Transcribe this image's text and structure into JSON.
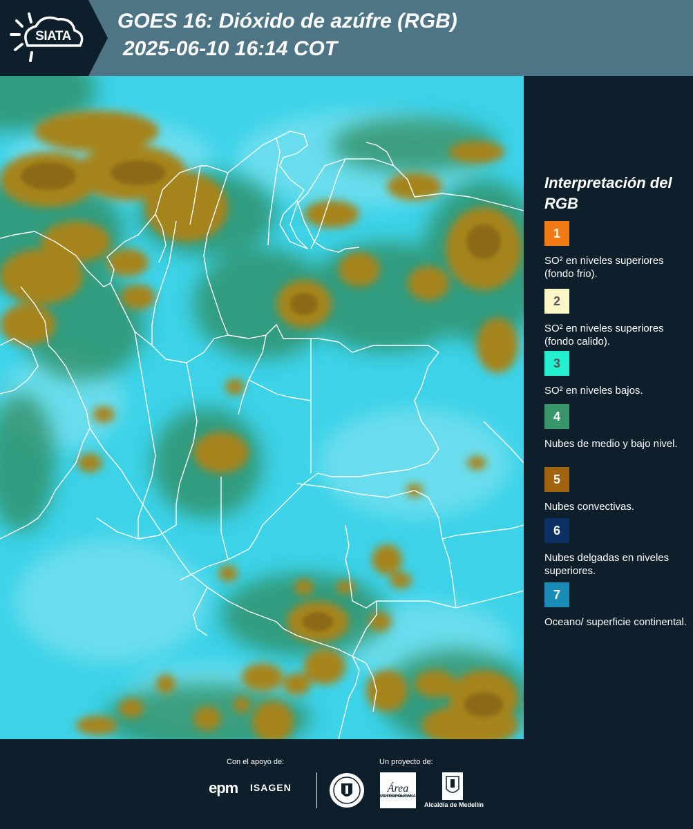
{
  "header": {
    "logo_text": "SIATA",
    "title_line_1": "GOES 16: Dióxido de azúfre (RGB)",
    "title_line_2": "2025-06-10 16:14 COT"
  },
  "legend": {
    "title": "Interpretación del RGB",
    "items": [
      {
        "number": "1",
        "label": "SO² en niveles superiores (fondo frio).",
        "color": "#f37b14",
        "text_color": "#ffffff"
      },
      {
        "number": "2",
        "label": "SO² en niveles superiores (fondo calido).",
        "color": "#fbf6c6",
        "text_color": "#555555"
      },
      {
        "number": "3",
        "label": "SO² en niveles bajos.",
        "color": "#22f0cf",
        "text_color": "#555555"
      },
      {
        "number": "4",
        "label": "Nubes de medio y bajo nivel.",
        "color": "#36966a",
        "text_color": "#ffffff"
      },
      {
        "number": "5",
        "label": "Nubes convectivas.",
        "color": "#a0650c",
        "text_color": "#ffffff"
      },
      {
        "number": "6",
        "label": "Nubes delgadas en niveles superiores.",
        "color": "#0d3064",
        "text_color": "#ffffff"
      },
      {
        "number": "7",
        "label": "Oceano/ superficie continental.",
        "color": "#1a8db6",
        "text_color": "#ffffff"
      }
    ]
  },
  "footer": {
    "support_label": "Con el apoyo de:",
    "project_label": "Un proyecto de:",
    "sponsor_1": "epm",
    "sponsor_2": "ISAGEN",
    "partner_1": "Área",
    "partner_1_sub": "METROPOLITANA",
    "partner_2": "Alcaldía de Medellín"
  },
  "colors": {
    "header_bg": "#4d7585",
    "panel_bg": "#0e1f2c",
    "surface": "#3ad0e6",
    "cloud": "#a6841f",
    "low_cloud": "#2e8a5c"
  }
}
